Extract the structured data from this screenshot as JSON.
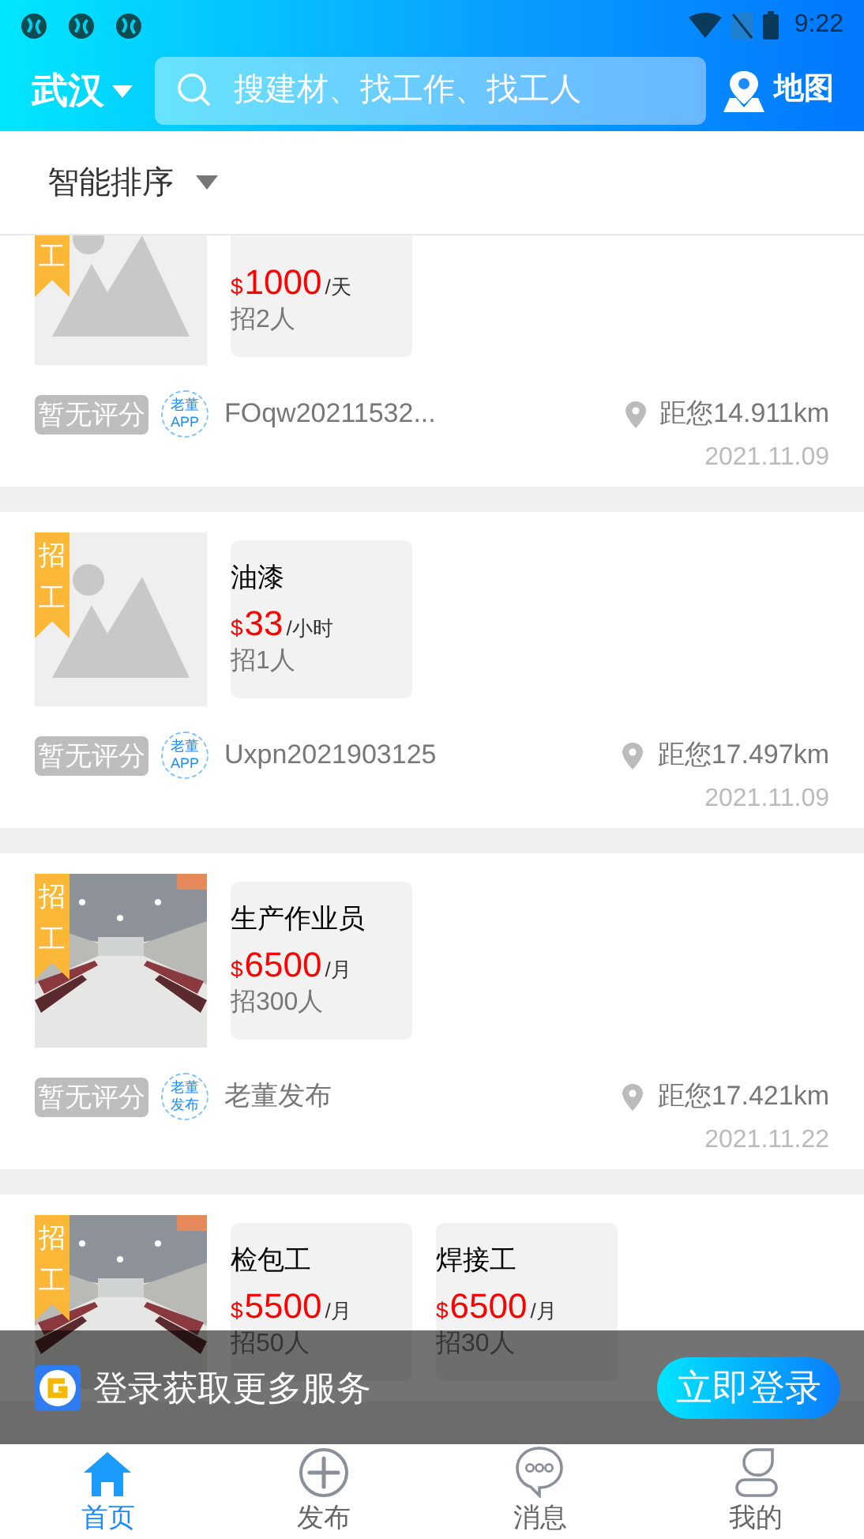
{
  "status_bar": {
    "time": "9:22"
  },
  "header": {
    "city": "武汉",
    "search": {
      "placeholder": "搜建材、找工作、找工人"
    },
    "map_label": "地图"
  },
  "sort": {
    "label": "智能排序"
  },
  "listings": [
    {
      "tag": "工",
      "image": {
        "kind": "placeholder"
      },
      "jobs": [
        {
          "currency": "$",
          "price": "1000",
          "unit": "/天",
          "headcount": "招2人"
        }
      ],
      "rating": "暂无评分",
      "publisher_logo": [
        "老董",
        "APP"
      ],
      "publisher": "FOqw20211532...",
      "distance": "距您14.911km",
      "date": "2021.11.09"
    },
    {
      "tag": "招工",
      "image": {
        "kind": "placeholder"
      },
      "jobs": [
        {
          "title": "油漆",
          "currency": "$",
          "price": "33",
          "unit": "/小时",
          "headcount": "招1人"
        }
      ],
      "rating": "暂无评分",
      "publisher_logo": [
        "老董",
        "APP"
      ],
      "publisher": "Uxpn2021903125",
      "distance": "距您17.497km",
      "date": "2021.11.09"
    },
    {
      "tag": "招工",
      "image": {
        "kind": "picture"
      },
      "jobs": [
        {
          "title": "生产作业员",
          "currency": "$",
          "price": "6500",
          "unit": "/月",
          "headcount": "招300人"
        }
      ],
      "rating": "暂无评分",
      "publisher_logo": [
        "老董",
        "发布"
      ],
      "publisher": "老董发布",
      "distance": "距您17.421km",
      "date": "2021.11.22"
    },
    {
      "tag": "招工",
      "image": {
        "kind": "picture"
      },
      "jobs": [
        {
          "title": "检包工",
          "currency": "$",
          "price": "5500",
          "unit": "/月",
          "headcount": "招50人"
        },
        {
          "title": "焊接工",
          "currency": "$",
          "price": "6500",
          "unit": "/月",
          "headcount": "招30人"
        }
      ]
    }
  ],
  "login_banner": {
    "text": "登录获取更多服务",
    "button": "立即登录"
  },
  "tab_bar": [
    {
      "kind": "home",
      "label": "首页",
      "selected": true
    },
    {
      "kind": "publish",
      "label": "发布",
      "selected": false
    },
    {
      "kind": "message",
      "label": "消息",
      "selected": false
    },
    {
      "kind": "profile",
      "label": "我的",
      "selected": false
    }
  ]
}
